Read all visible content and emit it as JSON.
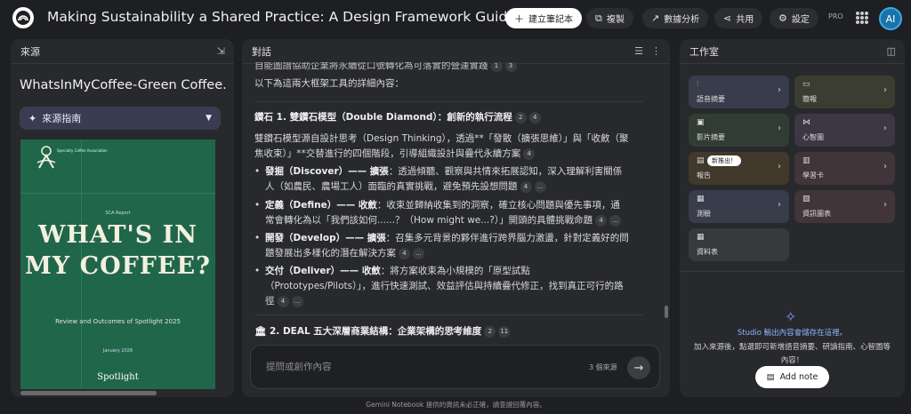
{
  "app": {
    "title": "Making Sustainability a Shared Practice: A Design Framework Guide",
    "pro_label": "PRO",
    "avatar_initials": "AI"
  },
  "toolbar": {
    "create_notebook": "建立筆記本",
    "copy": "複製",
    "analytics": "數據分析",
    "share": "共用",
    "settings": "設定"
  },
  "sources": {
    "header": "來源",
    "source_title": "WhatsInMyCoffee-Green Coffee...",
    "guide_label": "來源指南",
    "cover": {
      "seal_text": "Specialty Coffee Association",
      "report_label": "SCA Report",
      "headline": "WHAT'S IN MY COFFEE?",
      "subtitle": "Review and Outcomes of Spotlight 2025",
      "date": "January 2026",
      "brand": "Spotlight"
    }
  },
  "chat": {
    "header": "對話",
    "cut_line": "自能圖譜協助企業將永續從口號轉化為可落實的營運實踐",
    "cut_cites": [
      "1",
      "3"
    ],
    "intro": "以下為這兩大框架工具的詳細內容：",
    "section1": {
      "title": "鑽石 1. 雙鑽石模型（Double Diamond）：創新的執行流程",
      "cites": [
        "2",
        "4"
      ]
    },
    "s1_body_line1": "雙鑽石模型源自設計思考（Design Thinking），透過**「發散（擴張思維）」與「收斂（聚",
    "s1_body_line2": "焦收束）」**交替進行的四個階段，引導組織設計與疊代永續方案",
    "s1_body_cite": "4",
    "bullets": [
      {
        "bold": "發掘（Discover）—— 擴張",
        "line1": "：透過傾聽、觀察與共情來拓展認知，深入理解利害關係",
        "line2": "人（如農民、農場工人）面臨的真實挑戰，避免預先設想問題",
        "cites": [
          "4",
          "..."
        ]
      },
      {
        "bold": "定義（Define）—— 收斂",
        "line1": "：收束並歸納收集到的洞察，確立核心問題與優先事項，通",
        "line2": "常會轉化為以「我們該如何......？（How might we...?）」開頭的具體挑戰命題",
        "cites": [
          "4",
          "..."
        ]
      },
      {
        "bold": "開發（Develop）—— 擴張",
        "line1": "：召集多元背景的夥伴進行跨界腦力激盪，針對定義好的問",
        "line2": "題發展出多樣化的潛在解決方案",
        "cites": [
          "4",
          "..."
        ]
      },
      {
        "bold": "交付（Deliver）—— 收斂",
        "line1": "：將方案收束為小規模的「原型試點",
        "line2": "（Prototypes/Pilots）」，進行快速測試、效益評估與持續疊代修正，找到真正可行的路",
        "line3": "徑",
        "cites": [
          "4",
          "..."
        ]
      }
    ],
    "section2": {
      "title": "2. DEAL 五大深層商業結構：企業架構的思考維度",
      "cites": [
        "2",
        "11"
      ]
    },
    "input_placeholder": "提問或創作內容",
    "source_count": "3 個來源",
    "disclaimer": "Gemini Notebook 提供的資訊未必正確，請查證回覆內容。"
  },
  "studio": {
    "header": "工作室",
    "tiles": [
      {
        "label": "語音摘要",
        "icon": "audio-icon"
      },
      {
        "label": "簡報",
        "icon": "slides-icon"
      },
      {
        "label": "影片摘要",
        "icon": "video-icon"
      },
      {
        "label": "心智圖",
        "icon": "mindmap-icon"
      },
      {
        "label": "報告",
        "icon": "report-icon",
        "badge": "新推出！"
      },
      {
        "label": "學習卡",
        "icon": "flashcard-icon"
      },
      {
        "label": "測驗",
        "icon": "quiz-icon"
      },
      {
        "label": "資訊圖表",
        "icon": "infographic-icon"
      },
      {
        "label": "資料表",
        "icon": "table-icon"
      }
    ],
    "empty_title": "Studio 輸出內容會儲存在這裡。",
    "empty_desc": "加入來源後，點選即可新增語音摘要、研讀指南、心智圖等內容！",
    "add_note": "Add note"
  },
  "colors": {
    "accent": "#8ab4ff",
    "cover": "#20664a",
    "background": "#1e1f22"
  }
}
